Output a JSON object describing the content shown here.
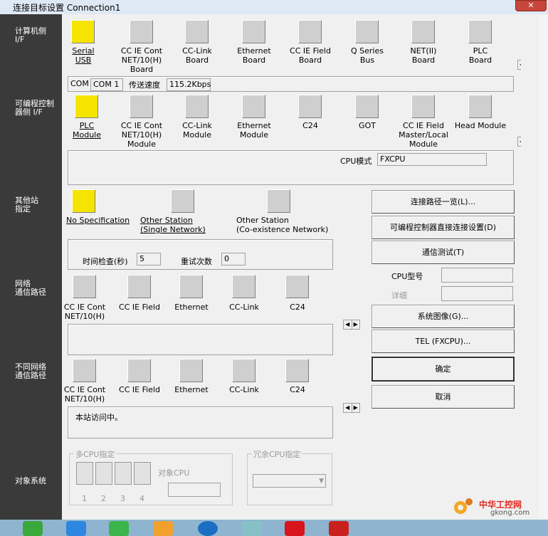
{
  "window": {
    "title": "连接目标设置 Connection1",
    "close_glyph": "✕"
  },
  "left_labels": {
    "pc_if": "计算机侧\nI/F",
    "plc_if": "可编程控制\n器侧 I/F",
    "other_station": "其他站\n指定",
    "network_route": "网络\n通信路径",
    "diff_network_route": "不同网络\n通信路径",
    "target_system": "对象系统"
  },
  "pc_side_icons": [
    {
      "label": "Serial\nUSB",
      "selected": true,
      "icon": "serial-usb-icon"
    },
    {
      "label": "CC IE Cont\nNET/10(H)\nBoard",
      "icon": "ccie-cont-board-icon"
    },
    {
      "label": "CC-Link\nBoard",
      "icon": "cclink-board-icon"
    },
    {
      "label": "Ethernet\nBoard",
      "icon": "ethernet-board-icon"
    },
    {
      "label": "CC IE Field\nBoard",
      "icon": "ccie-field-board-icon"
    },
    {
      "label": "Q Series\nBus",
      "icon": "q-series-bus-icon"
    },
    {
      "label": "NET(II)\nBoard",
      "icon": "net2-board-icon"
    },
    {
      "label": "PLC\nBoard",
      "icon": "plc-board-icon"
    }
  ],
  "com_row": {
    "com_label": "COM",
    "com_value": "COM 1",
    "speed_label": "传送速度",
    "speed_value": "115.2Kbps"
  },
  "plc_side_icons": [
    {
      "label": "PLC\nModule",
      "selected": true,
      "icon": "plc-module-icon"
    },
    {
      "label": "CC IE Cont\nNET/10(H)\nModule",
      "icon": "ccie-cont-module-icon"
    },
    {
      "label": "CC-Link\nModule",
      "icon": "cclink-module-icon"
    },
    {
      "label": "Ethernet\nModule",
      "icon": "ethernet-module-icon"
    },
    {
      "label": "C24",
      "icon": "c24-icon"
    },
    {
      "label": "GOT",
      "icon": "got-icon"
    },
    {
      "label": "CC IE Field\nMaster/Local\nModule",
      "icon": "ccie-field-master-icon"
    },
    {
      "label": "Head Module",
      "icon": "head-module-icon"
    }
  ],
  "cpu_mode": {
    "label": "CPU模式",
    "value": "FXCPU"
  },
  "other_station_icons": [
    {
      "label": "No Specification",
      "selected": true,
      "icon": "no-spec-icon"
    },
    {
      "label": "Other Station\n(Single Network)",
      "icon": "single-network-icon"
    },
    {
      "label": "Other Station\n(Co-existence Network)",
      "icon": "coexistence-network-icon"
    }
  ],
  "timing": {
    "time_check_label": "时间检查(秒)",
    "time_check_value": "5",
    "retry_label": "重试次数",
    "retry_value": "0"
  },
  "route_icons": [
    {
      "label": "CC IE Cont\nNET/10(H)"
    },
    {
      "label": "CC IE Field"
    },
    {
      "label": "Ethernet"
    },
    {
      "label": "CC-Link"
    },
    {
      "label": "C24"
    }
  ],
  "diff_route_icons": [
    {
      "label": "CC IE Cont\nNET/10(H)"
    },
    {
      "label": "CC IE Field"
    },
    {
      "label": "Ethernet"
    },
    {
      "label": "CC-Link"
    },
    {
      "label": "C24"
    }
  ],
  "access_text": "本站访问中。",
  "buttons": {
    "route_list": "连接路径一览(L)...",
    "direct_connect": "可编程控制器直接连接设置(D)",
    "comm_test": "通信测试(T)",
    "system_image": "系统图像(G)...",
    "tel": "TEL (FXCPU)...",
    "ok": "确定",
    "cancel": "取消"
  },
  "cpu_info": {
    "type_label": "CPU型号",
    "detail_label": "详细"
  },
  "multi_cpu": {
    "title": "多CPU指定",
    "target_label": "对象CPU",
    "slots": [
      "1",
      "2",
      "3",
      "4"
    ]
  },
  "redundant_cpu": {
    "title": "冗余CPU指定"
  },
  "watermark": {
    "cn": "中华工控网",
    "url": "gkong.com"
  }
}
